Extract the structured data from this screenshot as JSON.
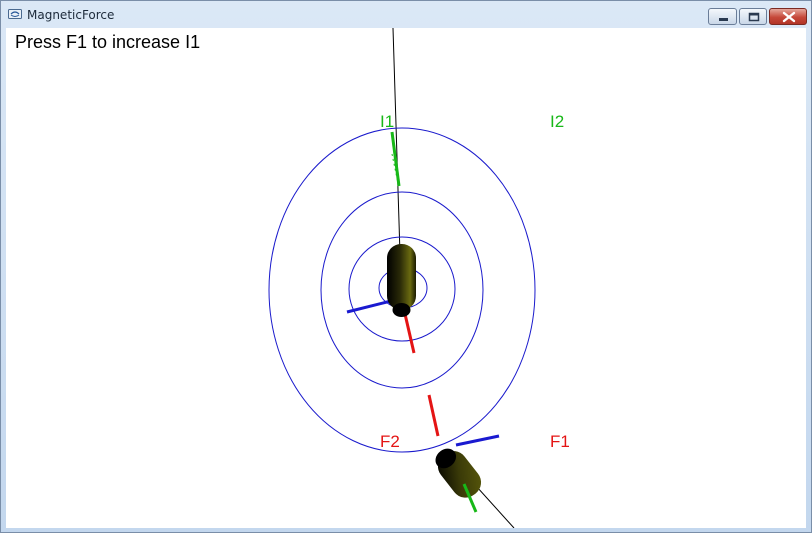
{
  "window": {
    "title": "MagneticForce",
    "icons": {
      "app": "app-window-icon",
      "minimize": "minimize-icon",
      "maximize": "maximize-icon",
      "close": "close-icon"
    }
  },
  "scene": {
    "hint": "Press F1 to increase I1",
    "labels": {
      "current1": "I1",
      "current2": "I2",
      "force2": "F2",
      "force1": "F1"
    },
    "colors": {
      "background": "#ffffff",
      "field_lines": "#1a1acc",
      "current_arrows": "#18b818",
      "force_arrows": "#e41414",
      "normal_arrows": "#1a1ad0",
      "wire": "#000000",
      "conductor": "#3a3a0a"
    }
  }
}
